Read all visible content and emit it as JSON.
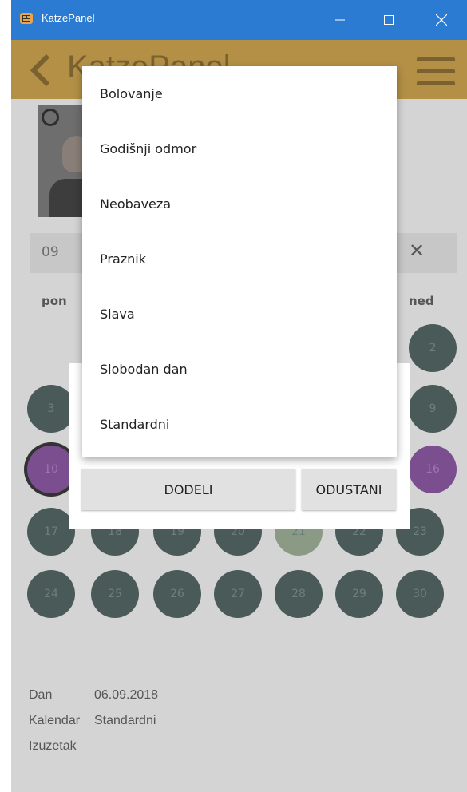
{
  "window": {
    "title": "KatzePanel",
    "titlebar_color": "#2b7bd3"
  },
  "appbar": {
    "title": "KatzePanel",
    "background": "#b39046"
  },
  "month": {
    "value": "09",
    "clear_label": "✕"
  },
  "calendar": {
    "weekdays_visible": [
      "pon",
      "ned"
    ],
    "days": [
      "2",
      "3",
      "9",
      "10",
      "16",
      "17",
      "18",
      "19",
      "20",
      "21",
      "22",
      "23",
      "24",
      "25",
      "26",
      "27",
      "28",
      "29",
      "30"
    ],
    "selected_day": "10",
    "today": "21",
    "special_days": [
      "10",
      "16"
    ]
  },
  "info": {
    "dan_label": "Dan",
    "dan_value": "06.09.2018",
    "kalendar_label": "Kalendar",
    "kalendar_value": "Standardni",
    "izuzetak_label": "Izuzetak"
  },
  "dropdown": {
    "options": [
      "Bolovanje",
      "Godišnji odmor",
      "Neobaveza",
      "Praznik",
      "Slava",
      "Slobodan dan",
      "Standardni"
    ]
  },
  "dialog": {
    "assign_label": "DODELI",
    "cancel_label": "ODUSTANI"
  }
}
